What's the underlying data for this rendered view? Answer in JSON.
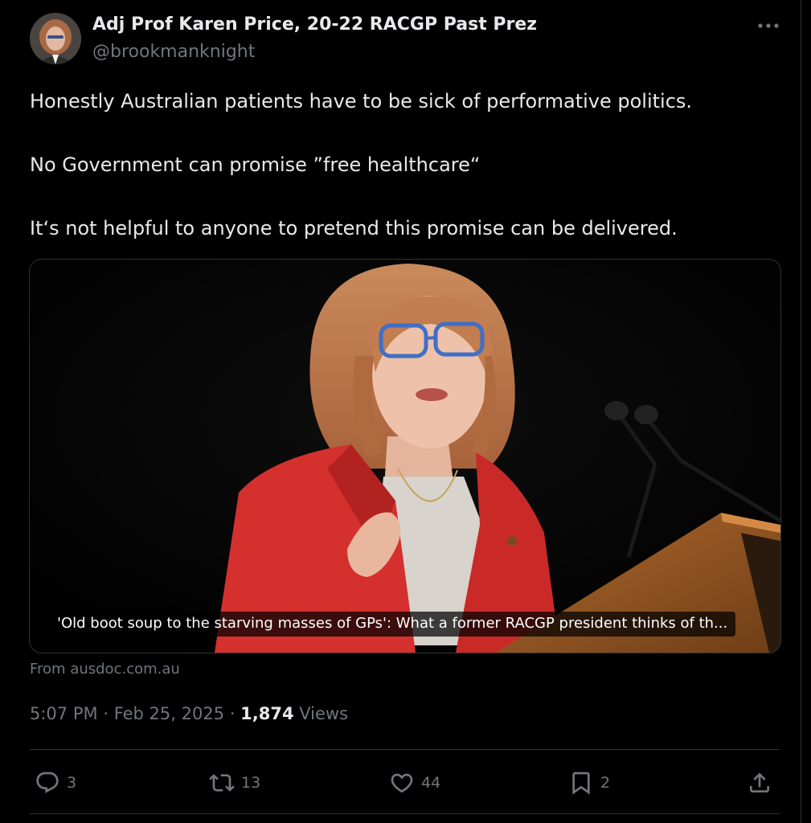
{
  "author": {
    "display_name": "Adj Prof Karen Price, 20-22 RACGP Past Prez",
    "handle": "@brookmanknight"
  },
  "tweet": {
    "paragraphs": [
      "Honestly Australian patients have to be sick of performative politics.",
      "No Government can promise ”free healthcare“",
      "It‘s not helpful to anyone to pretend this promise can be delivered."
    ]
  },
  "card": {
    "caption": "'Old boot soup to the starving masses of GPs': What a former RACGP president thinks of th...",
    "source": "From ausdoc.com.au"
  },
  "meta": {
    "time": "5:07 PM",
    "date": "Feb 25, 2025",
    "separator": "·",
    "views_count": "1,874",
    "views_label": "Views"
  },
  "actions": {
    "replies": "3",
    "reposts": "13",
    "likes": "44",
    "bookmarks": "2"
  },
  "colors": {
    "background": "#000000",
    "text_primary": "#e7e9ea",
    "text_secondary": "#71767b",
    "border": "#2f3336"
  },
  "icons": {
    "more": "more-horizontal-icon",
    "reply": "reply-icon",
    "repost": "repost-icon",
    "like": "heart-icon",
    "bookmark": "bookmark-icon",
    "share": "share-icon"
  }
}
